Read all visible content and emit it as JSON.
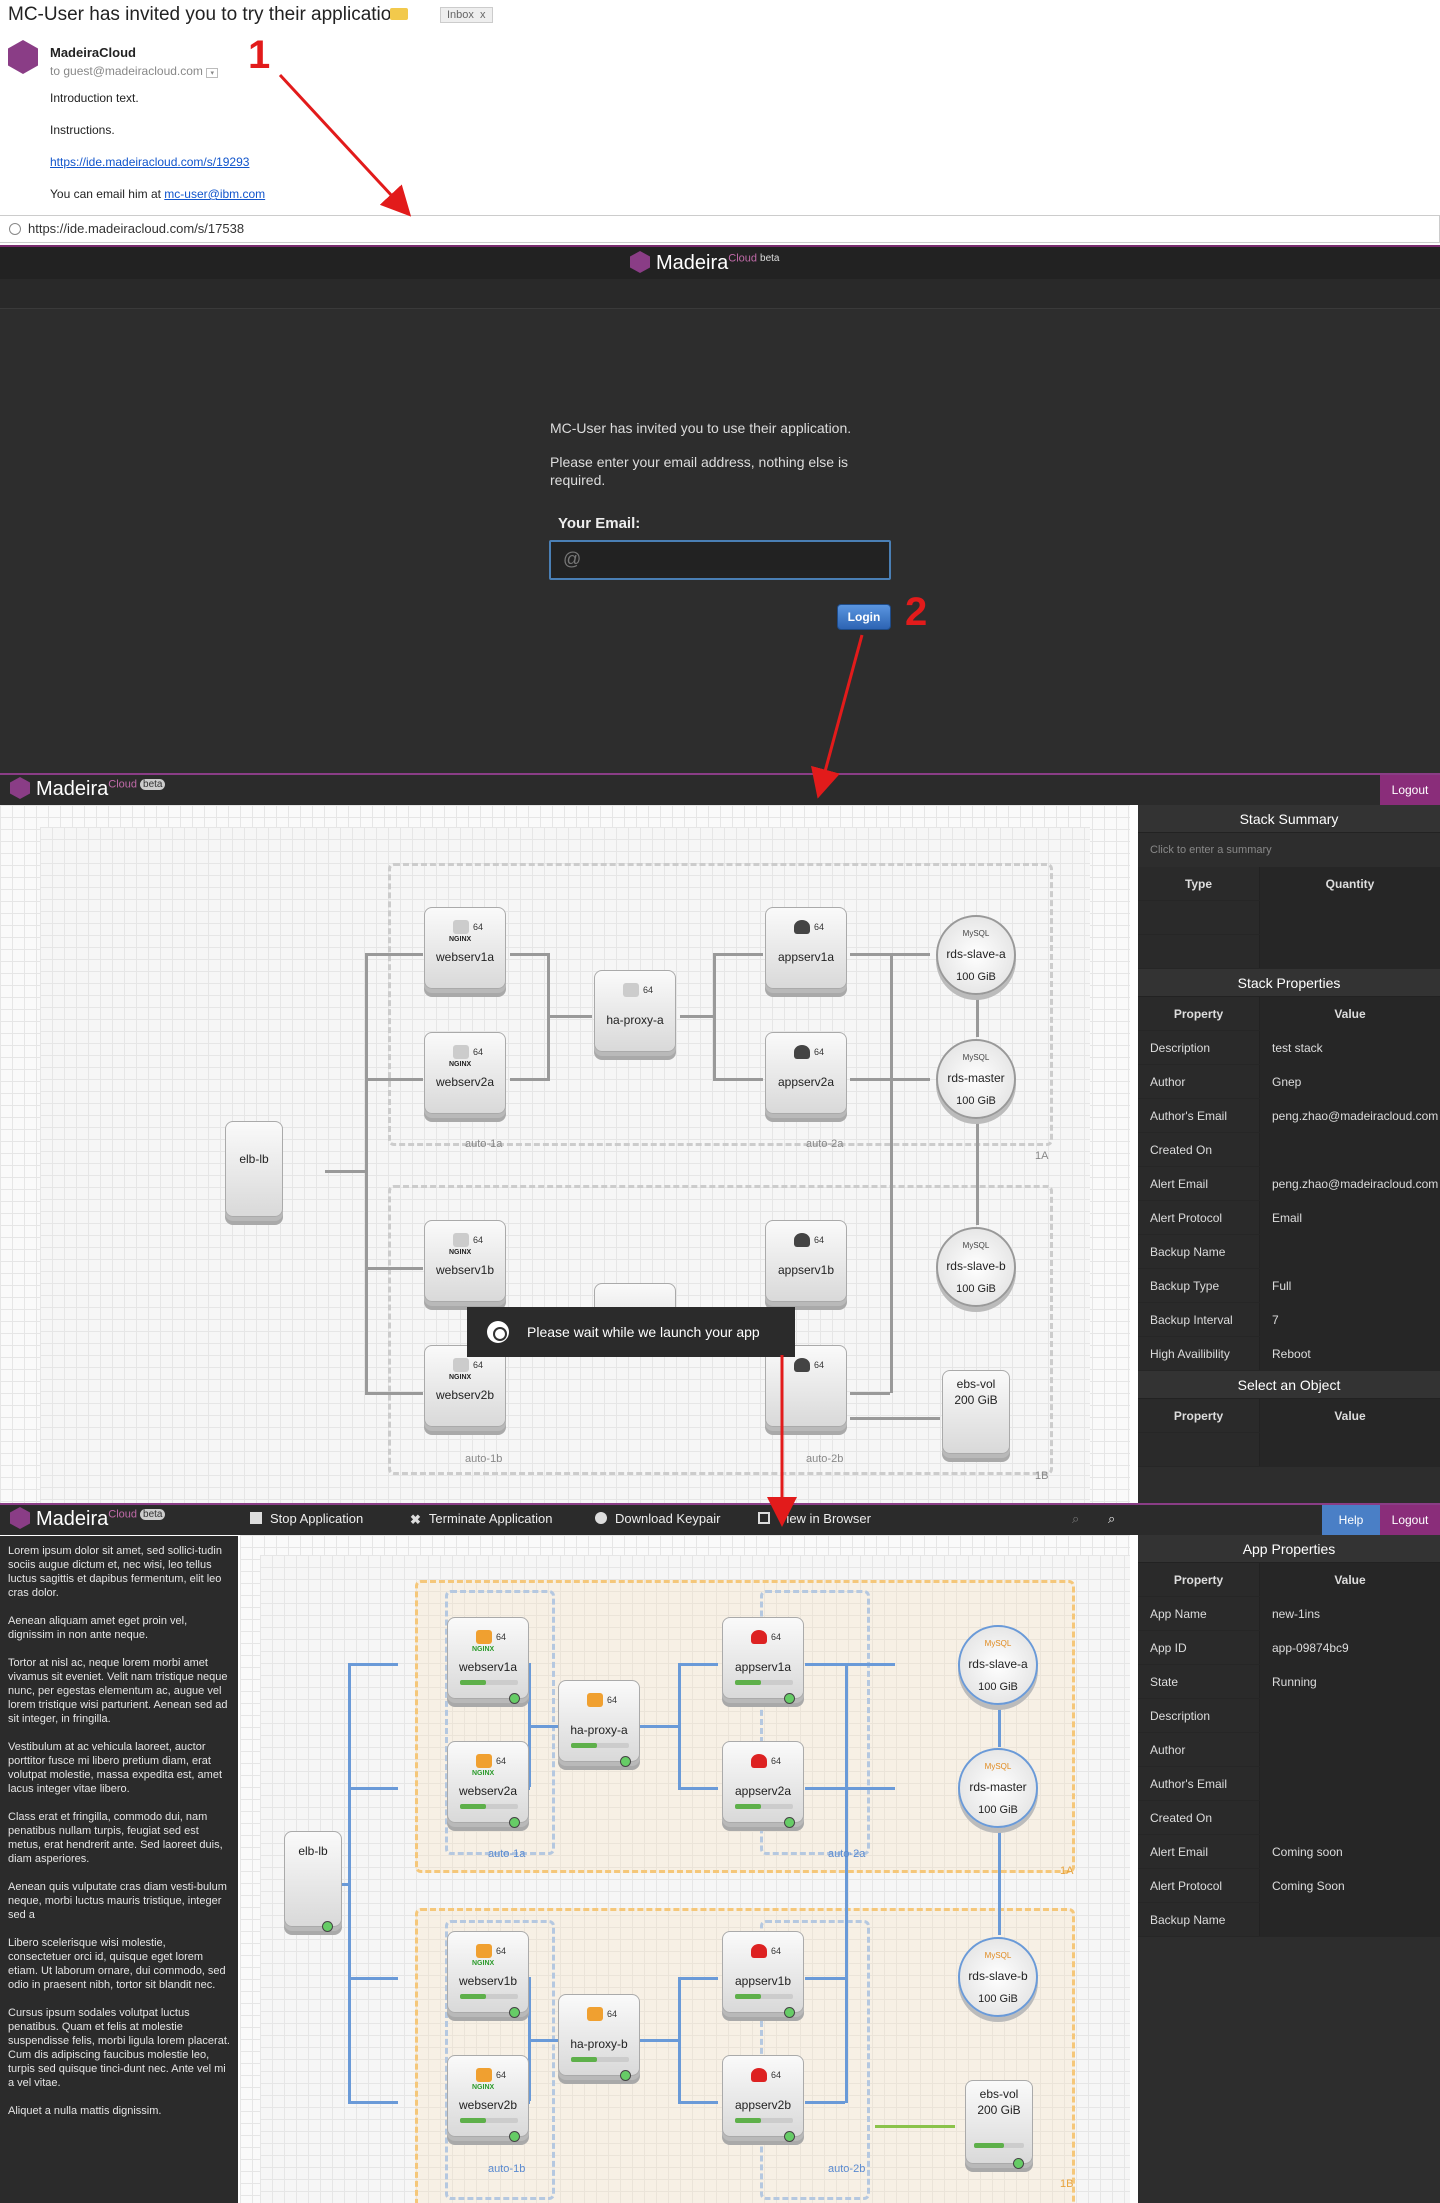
{
  "email": {
    "subject": "MC-User has invited you to try their application",
    "folder": "Inbox",
    "folder_close": "x",
    "sender": "MadeiraCloud",
    "to": "to guest@madeiracloud.com",
    "intro": "Introduction text.",
    "instructions": "Instructions.",
    "link": "https://ide.madeiracloud.com/s/19293",
    "contact_prefix": "You can email him at",
    "contact_email": "mc-user@ibm.com"
  },
  "address_bar": {
    "url": "https://ide.madeiracloud.com/s/17538"
  },
  "steps": {
    "one": "1",
    "two": "2"
  },
  "login": {
    "brand": "Madeira",
    "brand_sup": "Cloud",
    "brand_beta": "beta",
    "message": "MC-User has invited you to use their application.",
    "prompt": "Please enter your email address, nothing else is required.",
    "email_label": "Your Email:",
    "email_placeholder": "@",
    "login_button": "Login"
  },
  "stack_ide": {
    "brand": "Madeira",
    "brand_sup": "Cloud",
    "brand_beta": "beta",
    "logout": "Logout",
    "loader_text": "Please wait while we launch your app",
    "summary": {
      "title": "Stack Summary",
      "placeholder": "Click to enter a summary",
      "col_type": "Type",
      "col_quantity": "Quantity"
    },
    "properties": {
      "title": "Stack Properties",
      "col_property": "Property",
      "col_value": "Value",
      "rows": [
        {
          "k": "Description",
          "v": "test stack"
        },
        {
          "k": "Author",
          "v": "Gnep"
        },
        {
          "k": "Author's Email",
          "v": "peng.zhao@madeiracloud.com"
        },
        {
          "k": "Created On",
          "v": ""
        },
        {
          "k": "Alert Email",
          "v": "peng.zhao@madeiracloud.com"
        },
        {
          "k": "Alert Protocol",
          "v": "Email"
        },
        {
          "k": "Backup Name",
          "v": ""
        },
        {
          "k": "Backup Type",
          "v": "Full"
        },
        {
          "k": "Backup Interval",
          "v": "7"
        },
        {
          "k": "High Availibility",
          "v": "Reboot"
        }
      ]
    },
    "select_object": {
      "title": "Select an Object",
      "col_property": "Property",
      "col_value": "Value"
    },
    "nodes": {
      "elb": "elb-lb",
      "webserv1a": "webserv1a",
      "webserv2a": "webserv2a",
      "webserv1b": "webserv1b",
      "webserv2b": "webserv2b",
      "haproxy_a": "ha-proxy-a",
      "appserv1a": "appserv1a",
      "appserv2a": "appserv2a",
      "appserv1b": "appserv1b",
      "rds_slave_a": "rds-slave-a",
      "rds_master": "rds-master",
      "rds_slave_b": "rds-slave-b",
      "ebs": "ebs-vol",
      "ebs_size": "200 GiB",
      "db_size": "100 GiB",
      "bits": "64",
      "nginx": "NGINX",
      "mysql": "MySQL",
      "auto1a": "auto-1a",
      "auto2a": "auto-2a",
      "auto1b": "auto-1b",
      "auto2b": "auto-2b",
      "zone1a": "1A",
      "zone1b": "1B"
    }
  },
  "app_ide": {
    "brand": "Madeira",
    "brand_sup": "Cloud",
    "brand_beta": "beta",
    "toolbar": {
      "stop": "Stop Application",
      "terminate": "Terminate Application",
      "keypair": "Download Keypair",
      "browser": "View in Browser",
      "help": "Help",
      "logout": "Logout"
    },
    "left_text": [
      "Lorem ipsum dolor sit amet, sed sollici-tudin sociis augue dictum et, nec wisi, leo tellus luctus sagittis et dapibus fermentum, elit leo cras dolor.",
      "Aenean aliquam amet eget proin vel, dignissim in non ante neque.",
      "Tortor at nisl ac, neque lorem morbi amet vivamus sit eveniet. Velit nam tristique neque nunc, per egestas elementum ac, augue vel lorem tristique wisi parturient. Aenean sed ad sit integer, in fringilla.",
      "Vestibulum at ac vehicula laoreet, auctor porttitor fusce mi libero pretium diam, erat volutpat molestie, massa expedita est, amet lacus integer vitae libero.",
      "Class erat et fringilla, commodo dui, nam penatibus nullam turpis, feugiat sed est metus, erat hendrerit ante. Sed laoreet duis, diam asperiores.",
      "Aenean quis vulputate cras diam vesti-bulum neque, morbi luctus mauris tristique, integer sed a",
      "Libero scelerisque wisi molestie, consectetuer orci id, quisque eget lorem etiam. Ut laborum ornare, dui commodo, sed odio in praesent nibh, tortor sit blandit nec.",
      "Cursus ipsum sodales volutpat luctus penatibus. Quam et felis at molestie suspendisse felis, morbi ligula lorem placerat. Cum dis adipiscing faucibus molestie leo, turpis sed quisque tinci-dunt nec. Ante vel mi a vel vitae.",
      "Aliquet a nulla mattis dignissim."
    ],
    "properties": {
      "title": "App Properties",
      "col_property": "Property",
      "col_value": "Value",
      "rows": [
        {
          "k": "App Name",
          "v": "new-1ins"
        },
        {
          "k": "App ID",
          "v": "app-09874bc9"
        },
        {
          "k": "State",
          "v": "Running"
        },
        {
          "k": "Description",
          "v": ""
        },
        {
          "k": "Author",
          "v": ""
        },
        {
          "k": "Author's Email",
          "v": ""
        },
        {
          "k": "Created On",
          "v": ""
        },
        {
          "k": "Alert Email",
          "v": "Coming soon"
        },
        {
          "k": "Alert Protocol",
          "v": "Coming Soon"
        },
        {
          "k": "Backup Name",
          "v": ""
        }
      ]
    },
    "nodes": {
      "elb": "elb-lb",
      "webserv1a": "webserv1a",
      "webserv2a": "webserv2a",
      "webserv1b": "webserv1b",
      "webserv2b": "webserv2b",
      "haproxy_a": "ha-proxy-a",
      "haproxy_b": "ha-proxy-b",
      "appserv1a": "appserv1a",
      "appserv2a": "appserv2a",
      "appserv1b": "appserv1b",
      "appserv2b": "appserv2b",
      "rds_slave_a": "rds-slave-a",
      "rds_master": "rds-master",
      "rds_slave_b": "rds-slave-b",
      "ebs": "ebs-vol",
      "ebs_size": "200 GiB",
      "db_size": "100 GiB",
      "bits": "64",
      "nginx": "NGINX",
      "mysql": "MySQL",
      "auto1a": "auto-1a",
      "auto2a": "auto-2a",
      "auto1b": "auto-1b",
      "auto2b": "auto-2b",
      "zone1a": "1A",
      "zone1b": "1B"
    }
  }
}
